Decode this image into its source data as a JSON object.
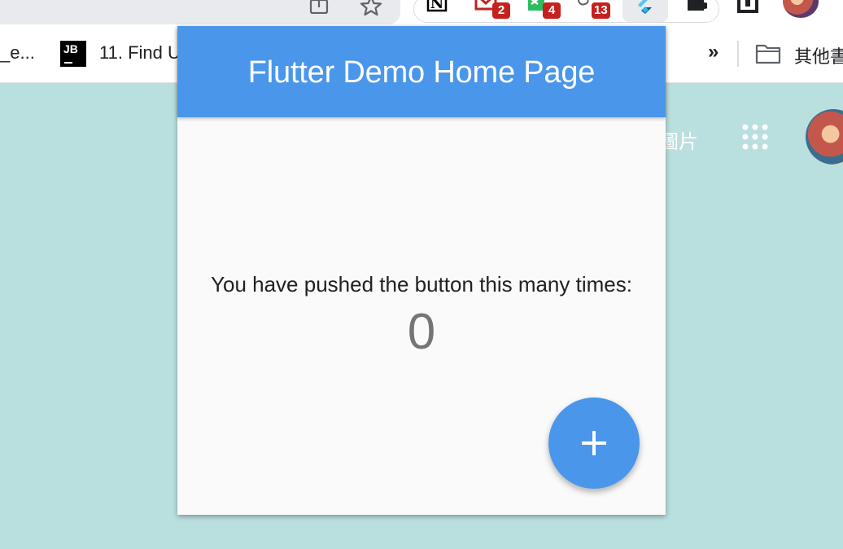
{
  "browser": {
    "extensions": [
      {
        "name": "notion-icon"
      },
      {
        "name": "gmail-icon",
        "badge": "2"
      },
      {
        "name": "evernote-icon",
        "badge": "4"
      },
      {
        "name": "extension-badge-icon",
        "badge": "13"
      },
      {
        "name": "flutter-icon"
      },
      {
        "name": "puzzle-icon"
      }
    ]
  },
  "bookmarks": {
    "items": [
      {
        "label": "_e..."
      },
      {
        "label": "11. Find U"
      }
    ],
    "overflow": "»",
    "folder_label": "其他書"
  },
  "page": {
    "images_link": "圖片"
  },
  "app": {
    "title": "Flutter Demo Home Page",
    "counter_label": "You have pushed the button this many times:",
    "counter_value": "0",
    "fab_label": "Increment"
  },
  "colors": {
    "primary": "#4a96eb",
    "background": "#badfdf",
    "badge": "#c5221f"
  }
}
